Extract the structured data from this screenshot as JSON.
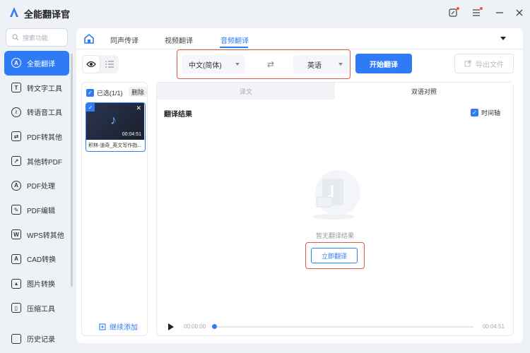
{
  "app": {
    "title": "全能翻译官"
  },
  "sidebar": {
    "search_placeholder": "搜索功能",
    "items": [
      {
        "label": "全能翻译",
        "icon": "translate-icon",
        "active": true
      },
      {
        "label": "转文字工具",
        "icon": "text-icon"
      },
      {
        "label": "转语音工具",
        "icon": "voice-icon"
      },
      {
        "label": "PDF转其他",
        "icon": "pdf-convert-icon"
      },
      {
        "label": "其他转PDF",
        "icon": "to-pdf-icon"
      },
      {
        "label": "PDF处理",
        "icon": "pdf-process-icon"
      },
      {
        "label": "PDF编辑",
        "icon": "pdf-edit-icon"
      },
      {
        "label": "WPS转其他",
        "icon": "wps-icon"
      },
      {
        "label": "CAD转换",
        "icon": "cad-icon"
      },
      {
        "label": "图片转换",
        "icon": "image-icon"
      },
      {
        "label": "压缩工具",
        "icon": "compress-icon"
      }
    ],
    "history": "历史记录"
  },
  "tabs": [
    {
      "label": "同声传译"
    },
    {
      "label": "视频翻译"
    },
    {
      "label": "音频翻译",
      "active": true
    }
  ],
  "toolbar": {
    "source_lang": "中文(简体)",
    "target_lang": "英语",
    "start_label": "开始翻译",
    "export_label": "导出文件"
  },
  "files": {
    "selected_label": "已选(1/1)",
    "delete_label": "删除",
    "items": [
      {
        "name": "积林-道奇_英文写作指...",
        "duration": "00:04:51"
      }
    ],
    "add_more": "继续添加"
  },
  "result": {
    "tabs": [
      "译文",
      "双语对照"
    ],
    "title": "翻译结果",
    "timeline_label": "时间轴",
    "empty_text": "暂无翻译结果",
    "translate_now": "立即翻译"
  },
  "player": {
    "current": "00:00:00",
    "total": "00:04:51"
  },
  "colors": {
    "accent": "#2f7bf5",
    "highlight_border": "#e05a4a"
  }
}
